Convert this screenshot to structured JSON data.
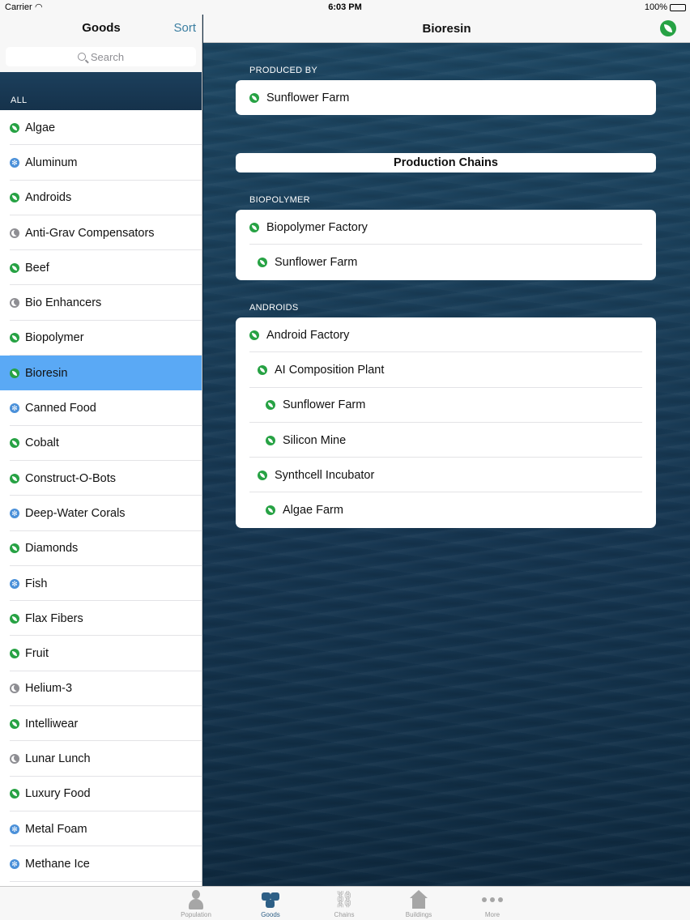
{
  "status_bar": {
    "carrier": "Carrier",
    "time": "6:03 PM",
    "battery": "100%"
  },
  "master": {
    "title": "Goods",
    "sort_label": "Sort",
    "search_placeholder": "Search",
    "section_label": "ALL",
    "items": [
      {
        "label": "Algae",
        "icon": "leaf-icon"
      },
      {
        "label": "Aluminum",
        "icon": "snowflake-icon"
      },
      {
        "label": "Androids",
        "icon": "leaf-icon"
      },
      {
        "label": "Anti-Grav Compensators",
        "icon": "moon-icon"
      },
      {
        "label": "Beef",
        "icon": "leaf-icon"
      },
      {
        "label": "Bio Enhancers",
        "icon": "moon-icon"
      },
      {
        "label": "Biopolymer",
        "icon": "leaf-icon"
      },
      {
        "label": "Bioresin",
        "icon": "leaf-icon",
        "selected": true
      },
      {
        "label": "Canned Food",
        "icon": "snowflake-icon"
      },
      {
        "label": "Cobalt",
        "icon": "leaf-icon"
      },
      {
        "label": "Construct-O-Bots",
        "icon": "leaf-icon"
      },
      {
        "label": "Deep-Water Corals",
        "icon": "snowflake-icon"
      },
      {
        "label": "Diamonds",
        "icon": "leaf-icon"
      },
      {
        "label": "Fish",
        "icon": "snowflake-icon"
      },
      {
        "label": "Flax Fibers",
        "icon": "leaf-icon"
      },
      {
        "label": "Fruit",
        "icon": "leaf-icon"
      },
      {
        "label": "Helium-3",
        "icon": "moon-icon"
      },
      {
        "label": "Intelliwear",
        "icon": "leaf-icon"
      },
      {
        "label": "Lunar Lunch",
        "icon": "moon-icon"
      },
      {
        "label": "Luxury Food",
        "icon": "leaf-icon"
      },
      {
        "label": "Metal Foam",
        "icon": "snowflake-icon"
      },
      {
        "label": "Methane Ice",
        "icon": "snowflake-icon"
      }
    ]
  },
  "detail": {
    "title": "Bioresin",
    "produced_by_label": "PRODUCED BY",
    "produced_by": [
      "Sunflower Farm"
    ],
    "chains_header": "Production Chains",
    "chains": [
      {
        "label": "BIOPOLYMER",
        "rows": [
          {
            "label": "Biopolymer Factory",
            "depth": 0
          },
          {
            "label": "Sunflower Farm",
            "depth": 1
          }
        ]
      },
      {
        "label": "ANDROIDS",
        "rows": [
          {
            "label": "Android Factory",
            "depth": 0
          },
          {
            "label": "AI Composition Plant",
            "depth": 1
          },
          {
            "label": "Sunflower Farm",
            "depth": 2
          },
          {
            "label": "Silicon Mine",
            "depth": 2
          },
          {
            "label": "Synthcell Incubator",
            "depth": 1
          },
          {
            "label": "Algae Farm",
            "depth": 2
          }
        ]
      }
    ]
  },
  "tabbar": {
    "tabs": [
      {
        "label": "Population",
        "icon": "person-icon"
      },
      {
        "label": "Goods",
        "icon": "goods-icon",
        "active": true
      },
      {
        "label": "Chains",
        "icon": "chain-icon"
      },
      {
        "label": "Buildings",
        "icon": "building-icon"
      },
      {
        "label": "More",
        "icon": "more-icon"
      }
    ]
  },
  "colors": {
    "accent": "#3b7ea1",
    "selection": "#5aa9f5",
    "leaf": "#27a244",
    "snow": "#4a90d9",
    "moon": "#8e8e93",
    "active_tab": "#2d5f86"
  }
}
